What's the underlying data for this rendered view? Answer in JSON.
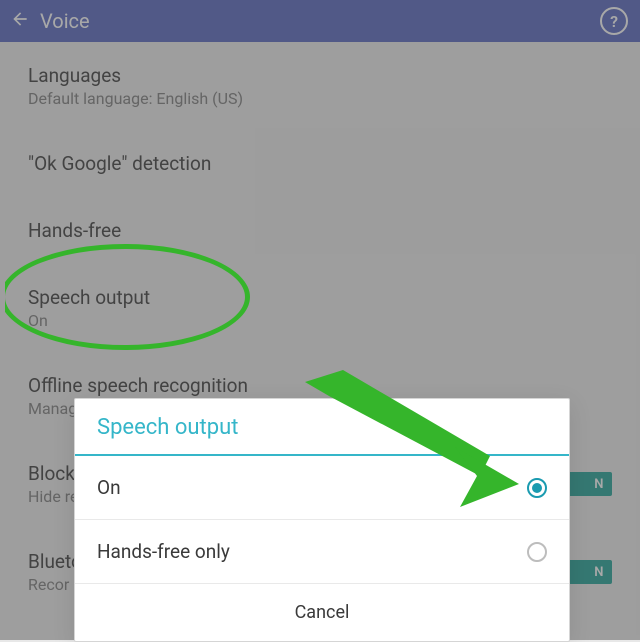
{
  "actionbar": {
    "title": "Voice"
  },
  "settings": {
    "languages_label": "Languages",
    "languages_value": "Default language: English (US)",
    "okgoogle_label": "\"Ok Google\" detection",
    "handsfree_label": "Hands-free",
    "speech_output_label": "Speech output",
    "speech_output_value": "On",
    "offline_label": "Offline speech recognition",
    "offline_value": "Manage downloaded languages",
    "block_label": "Block",
    "block_value": "Hide re",
    "bt_label": "Blueto",
    "bt_value": "Recor",
    "switch_on_text": "N"
  },
  "dialog": {
    "title": "Speech output",
    "options": [
      {
        "label": "On",
        "checked": true
      },
      {
        "label": "Hands-free only",
        "checked": false
      }
    ],
    "cancel": "Cancel"
  }
}
